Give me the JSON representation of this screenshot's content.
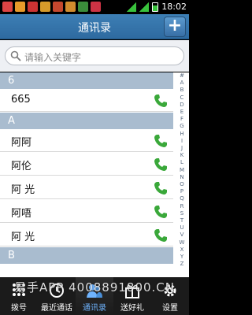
{
  "status_bar": {
    "time": "18:02"
  },
  "header": {
    "title": "通讯录",
    "add_label": "+"
  },
  "search": {
    "placeholder": "请输入关键字"
  },
  "sections": [
    {
      "letter": "6",
      "contacts": [
        "665"
      ]
    },
    {
      "letter": "A",
      "contacts": [
        "阿阿",
        "阿伦",
        "阿 光",
        "阿唔",
        "阿 光"
      ]
    },
    {
      "letter": "B",
      "contacts": []
    }
  ],
  "index_letters": [
    "#",
    "A",
    "B",
    "C",
    "D",
    "E",
    "F",
    "G",
    "H",
    "I",
    "J",
    "K",
    "L",
    "M",
    "N",
    "O",
    "P",
    "Q",
    "R",
    "S",
    "T",
    "U",
    "V",
    "W",
    "X",
    "Y",
    "Z"
  ],
  "watermark": "易手APP  4008891800.CN",
  "nav": {
    "tabs": [
      {
        "label": "拨号",
        "icon": "keypad-icon",
        "active": false
      },
      {
        "label": "最近通话",
        "icon": "recent-calls-icon",
        "active": false
      },
      {
        "label": "通讯录",
        "icon": "contacts-icon",
        "active": true
      },
      {
        "label": "送好礼",
        "icon": "gift-icon",
        "active": false
      },
      {
        "label": "设置",
        "icon": "settings-icon",
        "active": false
      }
    ]
  },
  "colors": {
    "header": "#3d7fb5",
    "section_header": "#a9bccf",
    "call_green": "#3aa83a",
    "active_tab": "#6fb4ff"
  }
}
